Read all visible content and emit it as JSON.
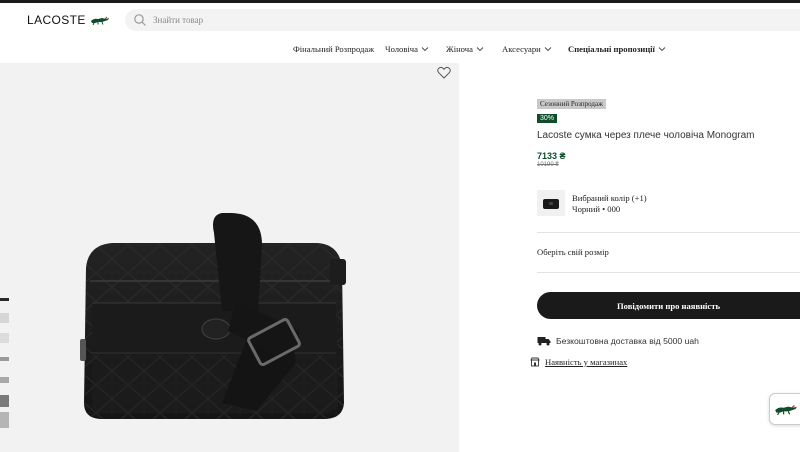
{
  "header": {
    "logo_text": "LACOSTE",
    "search_placeholder": "Знайти товар"
  },
  "nav": {
    "items": [
      {
        "label": "Фінальний Розпродаж",
        "has_dropdown": false
      },
      {
        "label": "Чоловіча",
        "has_dropdown": true
      },
      {
        "label": "Жіноча",
        "has_dropdown": true
      },
      {
        "label": "Аксесуари",
        "has_dropdown": true
      },
      {
        "label": "Спеціальні пропозиції",
        "has_dropdown": true
      }
    ]
  },
  "product": {
    "sale_badge": "Сезонний Розпродаж",
    "discount_badge": "30%",
    "title": "Lacoste сумка через плече чоловіча Monogram",
    "price": "7133 ₴",
    "old_price": "10190 ₴",
    "color_label": "Вибраний колір (+1)",
    "color_value": "Чорний • 000",
    "size_label": "Оберіть свій розмір",
    "notify_button": "Повідомити про наявність",
    "delivery_text": "Безкоштовна доставка від 5000 uah",
    "stores_text": "Наявність у магазинах"
  },
  "icons": {
    "search": "search-icon",
    "favorite": "heart-icon",
    "delivery": "truck-icon",
    "stores": "store-icon",
    "brand": "crocodile-icon"
  },
  "colors": {
    "brand_green": "#0f4d2b",
    "button_dark": "#1a1a1a",
    "gallery_bg": "#f2f2f2"
  }
}
